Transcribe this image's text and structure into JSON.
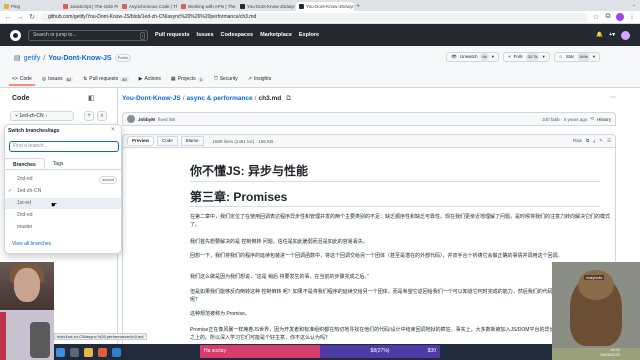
{
  "browser": {
    "tabs": [
      {
        "label": "Ping",
        "color": "#e0b33a"
      },
      {
        "label": "JavaScript | The Odin Project",
        "color": "#d95f5f"
      },
      {
        "label": "Asynchronous Code | The Odin Pr",
        "color": "#d95f5f"
      },
      {
        "label": "Working with APIs | The Odin Pro",
        "color": "#d95f5f"
      },
      {
        "label": "You-Dont-Know-JS/async & perf",
        "color": "#24292f"
      },
      {
        "label": "You-Dont-Know-JS/async & perf",
        "color": "#24292f"
      }
    ],
    "url": "github.com/getify/You-Dont-Know-JS/blob/1ed-zh-CN/async%20%26%20performance/ch3.md"
  },
  "github": {
    "search_placeholder": "Search or jump to...",
    "nav": [
      "Pull requests",
      "Issues",
      "Codespaces",
      "Marketplace",
      "Explore"
    ]
  },
  "repo": {
    "owner": "getify",
    "name": "You-Dont-Know-JS",
    "visibility": "Public",
    "watch": "Unwatch",
    "watch_count": "6k",
    "fork": "Fork",
    "fork_count": "32.7k",
    "star": "Star",
    "star_count": "169k",
    "tabs": [
      {
        "label": "Code",
        "count": ""
      },
      {
        "label": "Issues",
        "count": "82"
      },
      {
        "label": "Pull requests",
        "count": "49"
      },
      {
        "label": "Actions",
        "count": ""
      },
      {
        "label": "Projects",
        "count": "1"
      },
      {
        "label": "Security",
        "count": ""
      },
      {
        "label": "Insights",
        "count": ""
      }
    ]
  },
  "sidebar": {
    "title": "Code",
    "branch": "1ed-zh-CN"
  },
  "dropdown": {
    "title": "Switch branches/tags",
    "find_placeholder": "Find a branch...",
    "tabs": [
      "Branches",
      "Tags"
    ],
    "branches": [
      {
        "name": "2nd-ed",
        "badge": "default"
      },
      {
        "name": "1ed-zh-CN",
        "badge": ""
      },
      {
        "name": "1st-ed",
        "badge": ""
      },
      {
        "name": "2nd-ed",
        "badge": ""
      },
      {
        "name": "master",
        "badge": ""
      }
    ],
    "view_all": "View all branches"
  },
  "breadcrumb": {
    "repo": "You-Dont-Know-JS",
    "folder": "async & performance",
    "file": "ch3.md"
  },
  "commit": {
    "author": "JobbyM",
    "message": "fixed link",
    "hash_time": "340 fa5b · 5 years ago",
    "history": "History"
  },
  "file": {
    "views": [
      "Preview",
      "Code",
      "Blame"
    ],
    "meta": "1689 lines (1481 loc) · 165 KB"
  },
  "doc": {
    "title": "你不懂JS: 异步与性能",
    "chapter": "第三章: Promises",
    "paragraphs": [
      "在第二章中，我们定位了在使用回调表达程序异步性和管理并发的两个主要类别的不足：缺乏顺序性和缺乏可靠性。现在我们更亲近地理解了问题，是时候将我们的注意力转向解决它们的模式了。",
      "我们首先想要解决的是 控制倒转 问题，信任是如此脆弱而且是如此的容易丢失。",
      "回想一下，我们将我们的程序的延续包装进一个回调函数中，将这个回调交给另一个团体（甚至是潜在的外部代码），并双手合十祈祷它会做正确的事情并调用这个回调。",
      "我们这么做是因为我们想说，“这是 稍后 将要发生的事，在当前的步骤完成之后。”",
      "但是如果我们能够反向倒转这种 控制倒转 呢？如果不是将我们程序的延续交给另一个团体，而是希望它返回给我们一个可以知道它何时完成的能力，然后我们的代码可以决定下一步做什么呢？",
      "这种规范被称为 Promise。",
      "Promise正在像风暴一样席卷JS世界，因为开发者和标准组织都在热切地寻找在他们的代码/设计中结束回调地狱的疯狂。事实上，大多数新被加入JS/DOM平台的异步API都是建立在Promise之上的。所以深入学习它们可能是个好主意，你不这么认为吗？"
    ]
  },
  "stream": {
    "status_url": "blob/1ed-zh-CN/async %26 performance/ch3.md",
    "beaver_label": "malybobr",
    "donation_name": "Ha sozlay",
    "donation_progress": "$8(27%)",
    "donation_goal": "$30",
    "clock_time": "18:03",
    "clock_date": "16/06/2023"
  }
}
